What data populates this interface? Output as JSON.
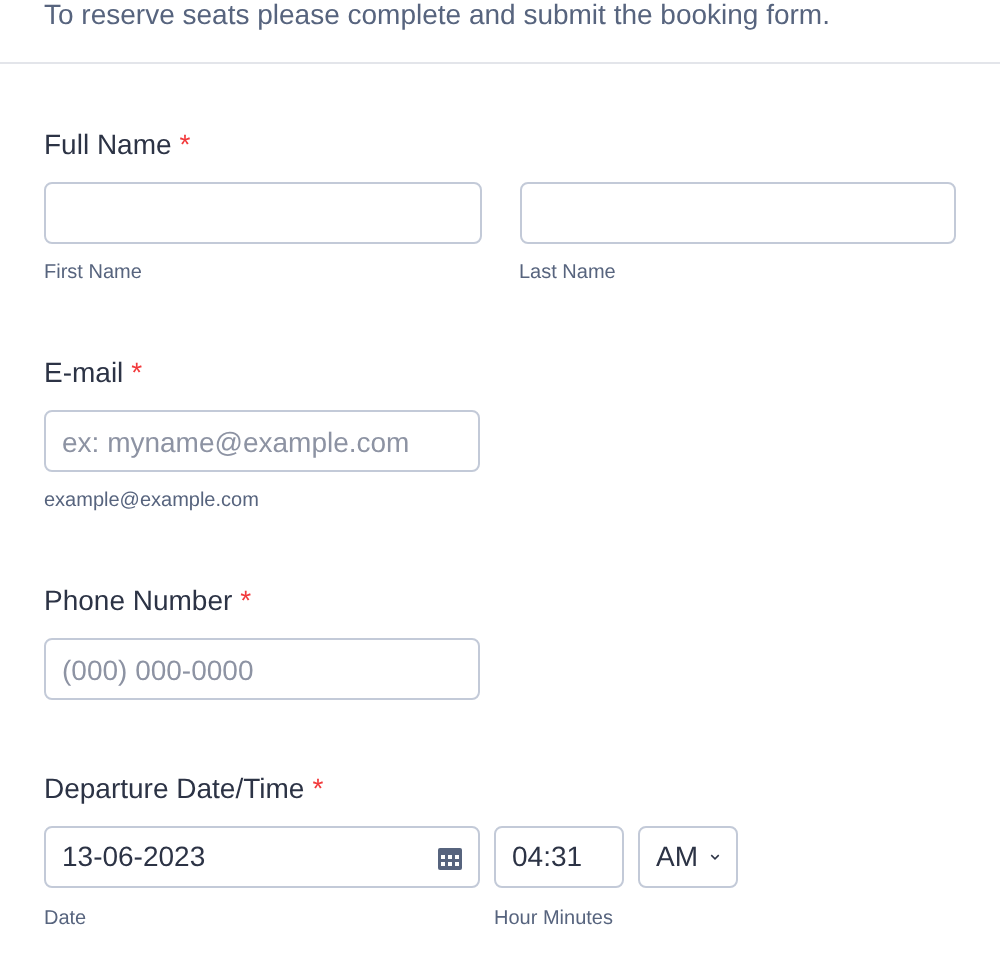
{
  "intro": "To reserve seats please complete and submit the booking form.",
  "fields": [
    {
      "kind": "name",
      "label": "Full Name",
      "required_mark": "*",
      "inputs": [
        {
          "sublabel": "First Name"
        },
        {
          "sublabel": "Last Name"
        }
      ]
    },
    {
      "kind": "email",
      "label": "E-mail",
      "required_mark": "*",
      "placeholder": "ex: myname@example.com",
      "sublabel": "example@example.com"
    },
    {
      "kind": "phone",
      "label": "Phone Number",
      "required_mark": "*",
      "placeholder": "(000) 000-0000"
    },
    {
      "kind": "datetime",
      "label": "Departure Date/Time",
      "required_mark": "*",
      "date": "13-06-2023",
      "time": "04:31",
      "ampm": "AM",
      "date_sublabel": "Date",
      "time_sublabel": "Hour Minutes"
    }
  ]
}
